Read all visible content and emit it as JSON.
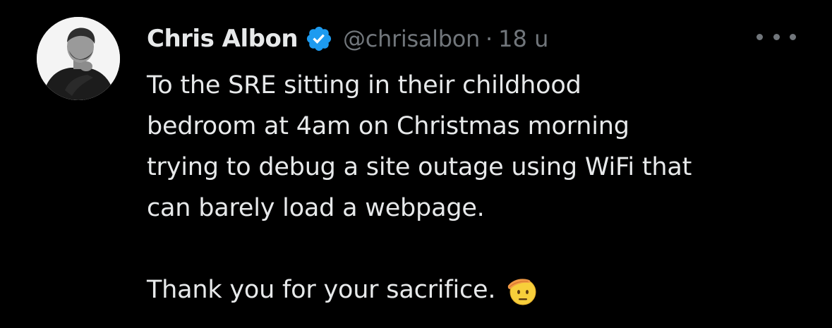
{
  "tweet": {
    "author": {
      "display_name": "Chris Albon",
      "handle": "@chrisalbon",
      "verified_icon": "verified-badge-icon",
      "verified_color": "#1d9bf0"
    },
    "separator": "·",
    "timestamp": "18 u",
    "more_icon": "more-options-icon",
    "text_lines": [
      "To the SRE sitting in their childhood",
      "bedroom at 4am on Christmas morning",
      "trying to debug a site outage using WiFi that",
      "can barely load a webpage."
    ],
    "closing_line": "Thank you for your sacrifice.",
    "closing_emoji": "saluting-face-emoji",
    "colors": {
      "background": "#000000",
      "text": "#e7e9ea",
      "secondary_text": "#71767b"
    }
  }
}
